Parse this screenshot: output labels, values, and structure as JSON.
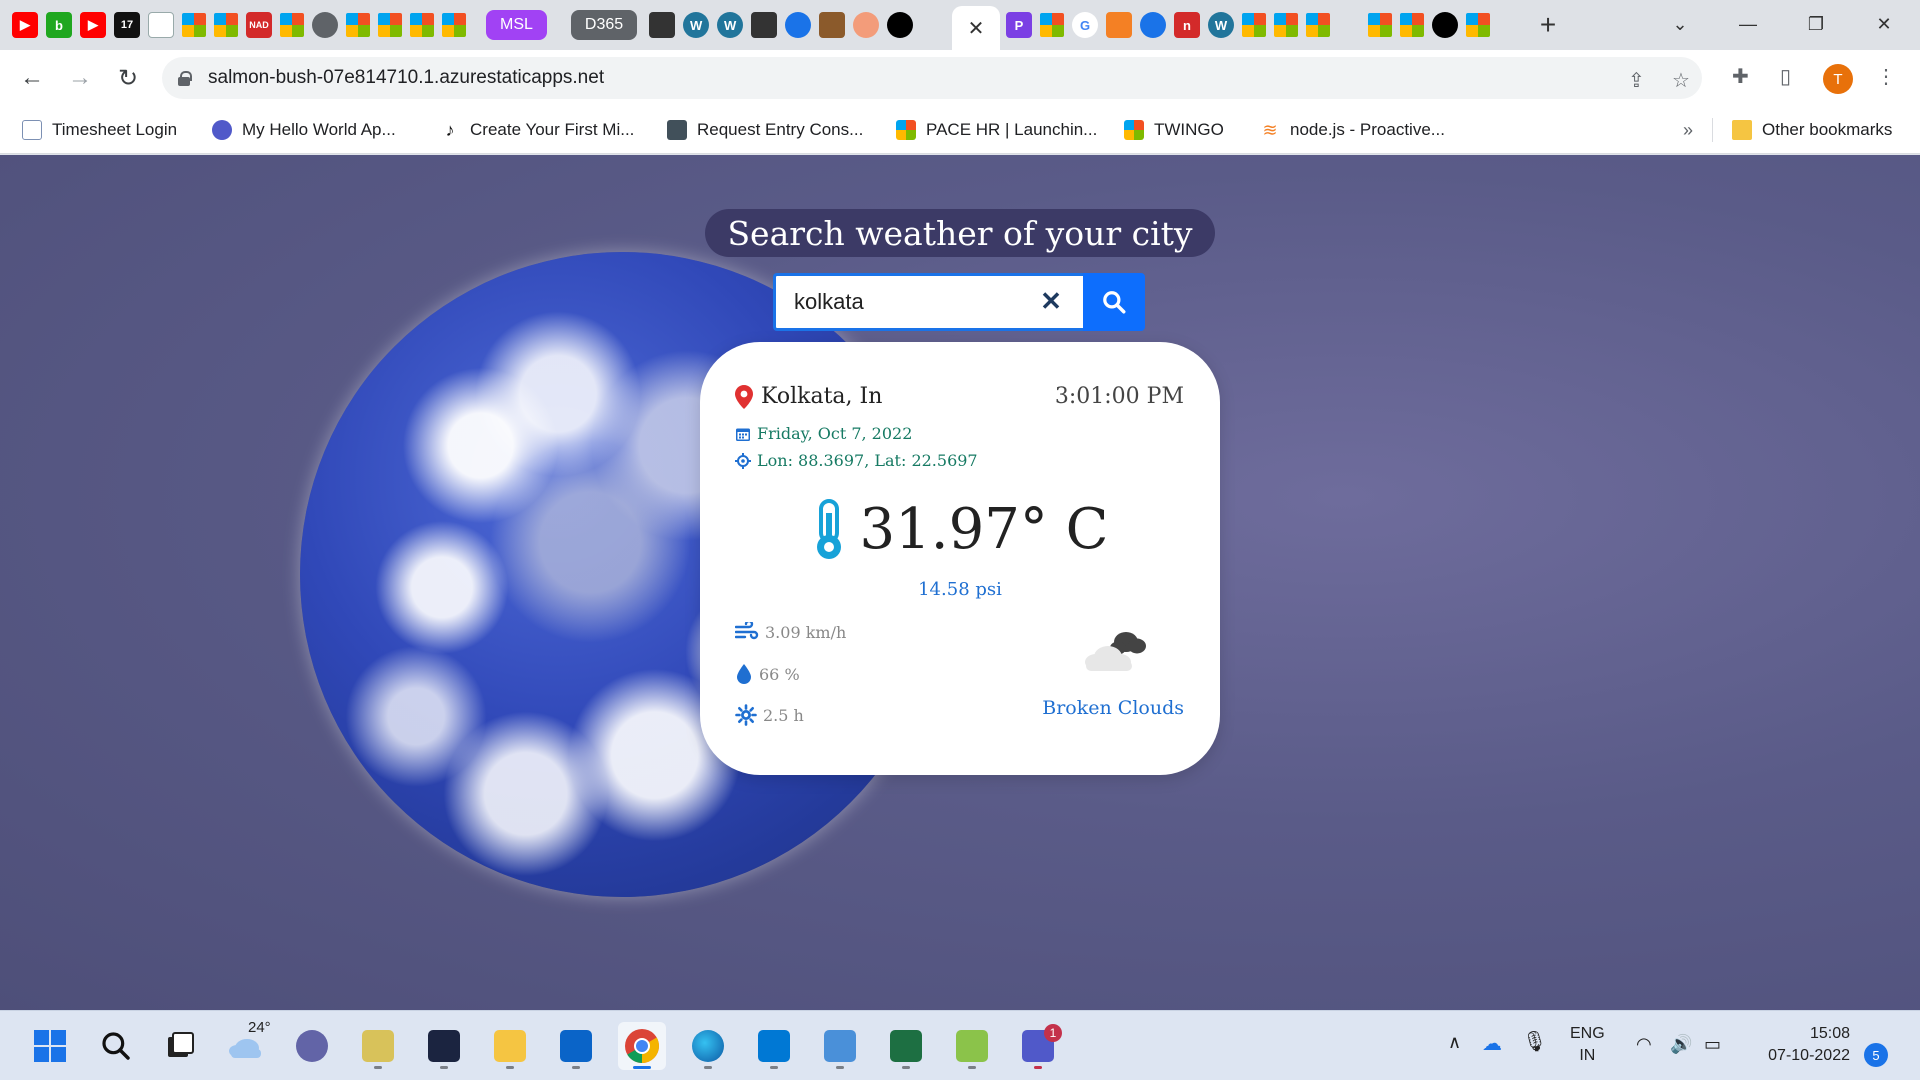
{
  "browser": {
    "tab_pills": [
      "MSL",
      "D365"
    ],
    "active_tab_close": "✕",
    "new_tab": "+",
    "url": "salmon-bush-07e814710.1.azurestaticapps.net",
    "profile_initial": "T"
  },
  "bookmarks": {
    "items": [
      {
        "label": "Timesheet Login",
        "icon": "document-icon"
      },
      {
        "label": "My Hello World Ap...",
        "icon": "teams-icon"
      },
      {
        "label": "Create Your First Mi...",
        "icon": "music-note-icon"
      },
      {
        "label": "Request Entry Cons...",
        "icon": "play-box-icon"
      },
      {
        "label": "PACE HR | Launchin...",
        "icon": "microsoft-icon"
      },
      {
        "label": "TWINGO",
        "icon": "microsoft-icon"
      },
      {
        "label": "node.js - Proactive...",
        "icon": "stackoverflow-icon"
      }
    ],
    "more": "»",
    "other": "Other bookmarks"
  },
  "app": {
    "title": "Search weather of your city",
    "search": {
      "value": "kolkata",
      "clear": "✕"
    },
    "weather": {
      "city": "Kolkata, In",
      "time": "3:01:00 PM",
      "date": "Friday, Oct 7, 2022",
      "coords": "Lon: 88.3697, Lat: 22.5697",
      "temperature": "31.97° C",
      "pressure": "14.58 psi",
      "wind": "3.09 km/h",
      "humidity": "66 %",
      "sun": "2.5 h",
      "condition": "Broken Clouds"
    },
    "colors": {
      "accent": "#0d6efd",
      "green": "#167a63",
      "link_blue": "#1f6fd1",
      "pin_red": "#e03131"
    }
  },
  "taskbar": {
    "weather_temp": "24°",
    "lang_top": "ENG",
    "lang_bottom": "IN",
    "clock_time": "15:08",
    "clock_date": "07-10-2022",
    "notifications": "5",
    "teams_badge": "1"
  }
}
